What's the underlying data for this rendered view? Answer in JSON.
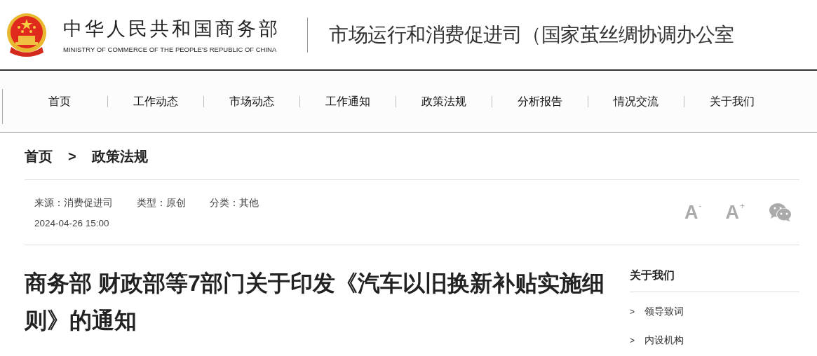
{
  "header": {
    "ministry_name": "中华人民共和国商务部",
    "ministry_name_en": "MINISTRY OF COMMERCE OF THE PEOPLE'S REPUBLIC OF CHINA",
    "department": "市场运行和消费促进司（国家茧丝绸协调办公室"
  },
  "nav": [
    {
      "label": "首页"
    },
    {
      "label": "工作动态"
    },
    {
      "label": "市场动态"
    },
    {
      "label": "工作通知"
    },
    {
      "label": "政策法规"
    },
    {
      "label": "分析报告"
    },
    {
      "label": "情况交流"
    },
    {
      "label": "关于我们"
    }
  ],
  "breadcrumb": {
    "home": "首页",
    "separator": ">",
    "current": "政策法规"
  },
  "meta": {
    "source": "来源：消费促进司",
    "type": "类型：原创",
    "category": "分类：其他",
    "date": "2024-04-26 15:00"
  },
  "font_buttons": [
    {
      "letter": "A",
      "sign": "-"
    },
    {
      "letter": "A",
      "sign": "+"
    }
  ],
  "article": {
    "title": "商务部 财政部等7部门关于印发《汽车以旧换新补贴实施细则》的通知"
  },
  "sidebar": {
    "title": "关于我们",
    "items": [
      {
        "marker": ">",
        "label": "领导致词"
      },
      {
        "marker": ">",
        "label": "内设机构"
      }
    ]
  }
}
